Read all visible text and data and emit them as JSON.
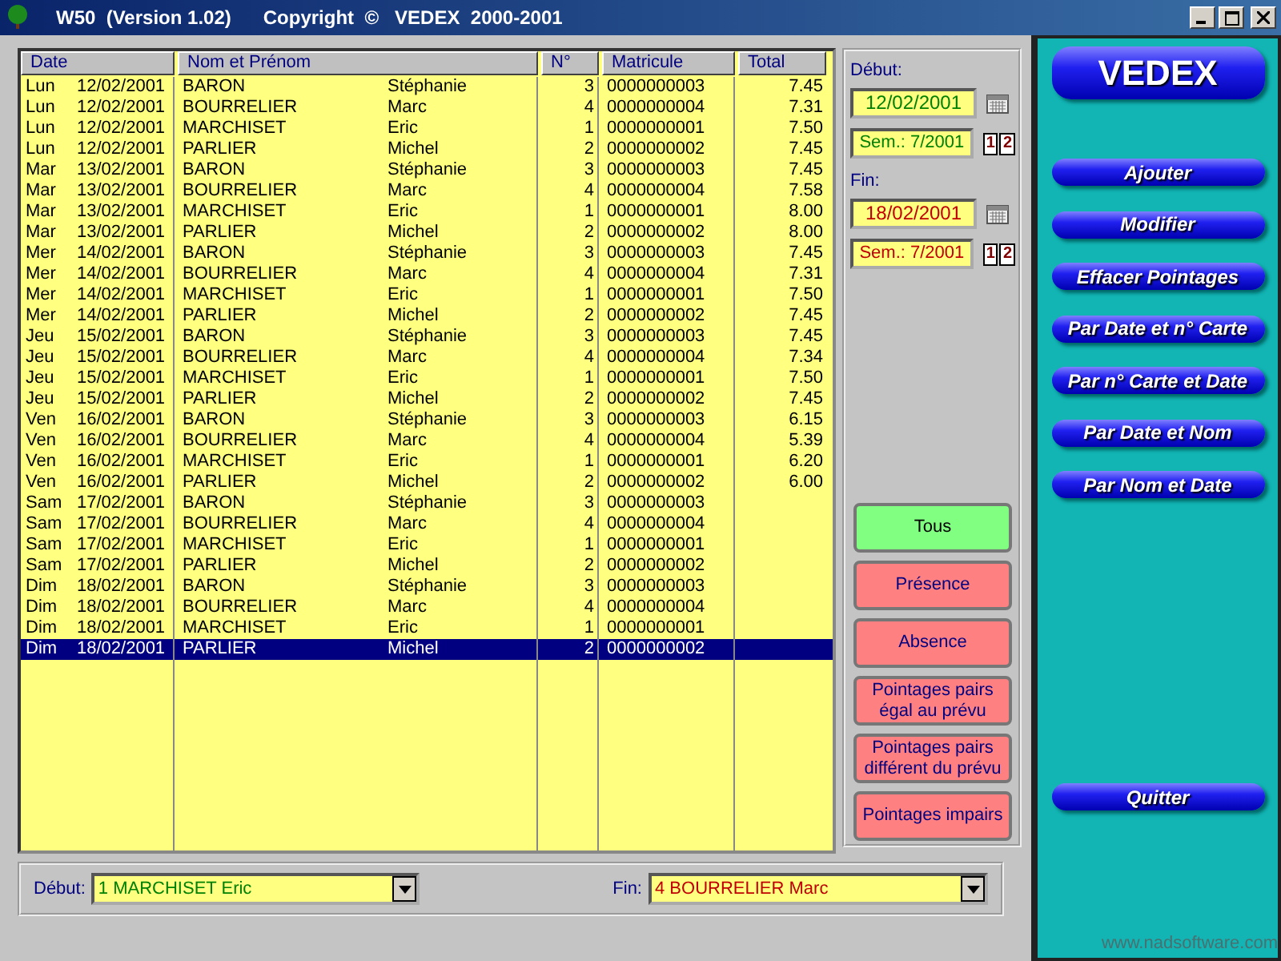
{
  "window": {
    "title": "W50  (Version 1.02)      Copyright  ©   VEDEX  2000-2001"
  },
  "table": {
    "columns": [
      "Date",
      "Nom et Prénom",
      "N°",
      "Matricule",
      "Total"
    ],
    "rows": [
      {
        "day": "Lun",
        "date": "12/02/2001",
        "nom": "BARON",
        "prenom": "Stéphanie",
        "numero": "3",
        "matricule": "0000000003",
        "total": "7.45",
        "selected": false
      },
      {
        "day": "Lun",
        "date": "12/02/2001",
        "nom": "BOURRELIER",
        "prenom": "Marc",
        "numero": "4",
        "matricule": "0000000004",
        "total": "7.31",
        "selected": false
      },
      {
        "day": "Lun",
        "date": "12/02/2001",
        "nom": "MARCHISET",
        "prenom": "Eric",
        "numero": "1",
        "matricule": "0000000001",
        "total": "7.50",
        "selected": false
      },
      {
        "day": "Lun",
        "date": "12/02/2001",
        "nom": "PARLIER",
        "prenom": "Michel",
        "numero": "2",
        "matricule": "0000000002",
        "total": "7.45",
        "selected": false
      },
      {
        "day": "Mar",
        "date": "13/02/2001",
        "nom": "BARON",
        "prenom": "Stéphanie",
        "numero": "3",
        "matricule": "0000000003",
        "total": "7.45",
        "selected": false
      },
      {
        "day": "Mar",
        "date": "13/02/2001",
        "nom": "BOURRELIER",
        "prenom": "Marc",
        "numero": "4",
        "matricule": "0000000004",
        "total": "7.58",
        "selected": false
      },
      {
        "day": "Mar",
        "date": "13/02/2001",
        "nom": "MARCHISET",
        "prenom": "Eric",
        "numero": "1",
        "matricule": "0000000001",
        "total": "8.00",
        "selected": false
      },
      {
        "day": "Mar",
        "date": "13/02/2001",
        "nom": "PARLIER",
        "prenom": "Michel",
        "numero": "2",
        "matricule": "0000000002",
        "total": "8.00",
        "selected": false
      },
      {
        "day": "Mer",
        "date": "14/02/2001",
        "nom": "BARON",
        "prenom": "Stéphanie",
        "numero": "3",
        "matricule": "0000000003",
        "total": "7.45",
        "selected": false
      },
      {
        "day": "Mer",
        "date": "14/02/2001",
        "nom": "BOURRELIER",
        "prenom": "Marc",
        "numero": "4",
        "matricule": "0000000004",
        "total": "7.31",
        "selected": false
      },
      {
        "day": "Mer",
        "date": "14/02/2001",
        "nom": "MARCHISET",
        "prenom": "Eric",
        "numero": "1",
        "matricule": "0000000001",
        "total": "7.50",
        "selected": false
      },
      {
        "day": "Mer",
        "date": "14/02/2001",
        "nom": "PARLIER",
        "prenom": "Michel",
        "numero": "2",
        "matricule": "0000000002",
        "total": "7.45",
        "selected": false
      },
      {
        "day": "Jeu",
        "date": "15/02/2001",
        "nom": "BARON",
        "prenom": "Stéphanie",
        "numero": "3",
        "matricule": "0000000003",
        "total": "7.45",
        "selected": false
      },
      {
        "day": "Jeu",
        "date": "15/02/2001",
        "nom": "BOURRELIER",
        "prenom": "Marc",
        "numero": "4",
        "matricule": "0000000004",
        "total": "7.34",
        "selected": false
      },
      {
        "day": "Jeu",
        "date": "15/02/2001",
        "nom": "MARCHISET",
        "prenom": "Eric",
        "numero": "1",
        "matricule": "0000000001",
        "total": "7.50",
        "selected": false
      },
      {
        "day": "Jeu",
        "date": "15/02/2001",
        "nom": "PARLIER",
        "prenom": "Michel",
        "numero": "2",
        "matricule": "0000000002",
        "total": "7.45",
        "selected": false
      },
      {
        "day": "Ven",
        "date": "16/02/2001",
        "nom": "BARON",
        "prenom": "Stéphanie",
        "numero": "3",
        "matricule": "0000000003",
        "total": "6.15",
        "selected": false
      },
      {
        "day": "Ven",
        "date": "16/02/2001",
        "nom": "BOURRELIER",
        "prenom": "Marc",
        "numero": "4",
        "matricule": "0000000004",
        "total": "5.39",
        "selected": false
      },
      {
        "day": "Ven",
        "date": "16/02/2001",
        "nom": "MARCHISET",
        "prenom": "Eric",
        "numero": "1",
        "matricule": "0000000001",
        "total": "6.20",
        "selected": false
      },
      {
        "day": "Ven",
        "date": "16/02/2001",
        "nom": "PARLIER",
        "prenom": "Michel",
        "numero": "2",
        "matricule": "0000000002",
        "total": "6.00",
        "selected": false
      },
      {
        "day": "Sam",
        "date": "17/02/2001",
        "nom": "BARON",
        "prenom": "Stéphanie",
        "numero": "3",
        "matricule": "0000000003",
        "selected": false
      },
      {
        "day": "Sam",
        "date": "17/02/2001",
        "nom": "BOURRELIER",
        "prenom": "Marc",
        "numero": "4",
        "matricule": "0000000004",
        "selected": false
      },
      {
        "day": "Sam",
        "date": "17/02/2001",
        "nom": "MARCHISET",
        "prenom": "Eric",
        "numero": "1",
        "matricule": "0000000001",
        "selected": false
      },
      {
        "day": "Sam",
        "date": "17/02/2001",
        "nom": "PARLIER",
        "prenom": "Michel",
        "numero": "2",
        "matricule": "0000000002",
        "selected": false
      },
      {
        "day": "Dim",
        "date": "18/02/2001",
        "nom": "BARON",
        "prenom": "Stéphanie",
        "numero": "3",
        "matricule": "0000000003",
        "selected": false
      },
      {
        "day": "Dim",
        "date": "18/02/2001",
        "nom": "BOURRELIER",
        "prenom": "Marc",
        "numero": "4",
        "matricule": "0000000004",
        "selected": false
      },
      {
        "day": "Dim",
        "date": "18/02/2001",
        "nom": "MARCHISET",
        "prenom": "Eric",
        "numero": "1",
        "matricule": "0000000001",
        "selected": false
      },
      {
        "day": "Dim",
        "date": "18/02/2001",
        "nom": "PARLIER",
        "prenom": "Michel",
        "numero": "2",
        "matricule": "0000000002",
        "selected": true
      }
    ]
  },
  "period": [
    {
      "label": "Début:",
      "date": "12/02/2001",
      "week": "Sem.: 7/2001",
      "week_icon": [
        "1",
        "2"
      ],
      "kind": "start"
    },
    {
      "label": "Fin:",
      "date": "18/02/2001",
      "week": "Sem.: 7/2001",
      "week_icon": [
        "1",
        "2"
      ],
      "kind": "end"
    }
  ],
  "filters": [
    {
      "label": "Tous",
      "selected": true
    },
    {
      "label": "Présence",
      "selected": false
    },
    {
      "label": "Absence",
      "selected": false
    },
    {
      "label": "Pointages pairs égal au prévu",
      "selected": false
    },
    {
      "label": "Pointages pairs différent du prévu",
      "selected": false
    },
    {
      "label": "Pointages impairs",
      "selected": false
    }
  ],
  "bottom": [
    {
      "label": "Début:",
      "value": "1 MARCHISET Eric",
      "kind": "start"
    },
    {
      "label": "Fin:",
      "value": "4 BOURRELIER Marc",
      "kind": "end"
    }
  ],
  "logo": "VEDEX",
  "actions": [
    "Ajouter",
    "Modifier",
    "Effacer Pointages",
    "Par Date et n° Carte",
    "Par n° Carte et Date",
    "Par Date et Nom",
    "Par Nom et Date"
  ],
  "quit": "Quitter",
  "footer_url": "www.nadsoftware.com"
}
